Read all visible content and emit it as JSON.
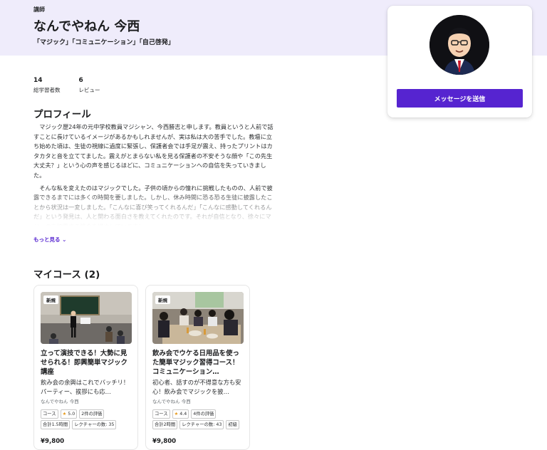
{
  "instructor": {
    "role": "講師",
    "name": "なんでやねん 今西",
    "tags": "「マジック」「コミュニケーション」「自己啓発」"
  },
  "stats": [
    {
      "value": "14",
      "label": "総学習者数"
    },
    {
      "value": "6",
      "label": "レビュー"
    }
  ],
  "side_card": {
    "message_button": "メッセージを送信"
  },
  "profile": {
    "title": "プロフィール",
    "paragraphs": [
      "マジック歴24年の元中学校教員マジシャン、今西勝志と申します。教員というと人前で話すことに長けているイメージがあるかもしれませんが、実は私は大の苦手でした。教壇に立ち始めた頃は、生徒の視線に過度に緊張し、保護者会では手足が震え、持ったプリントはカタカタと音を立ててました。震えがとまらない私を見る保護者の不安そうな顔や「この先生大丈夫？」という心の声を感じるほどに、コミュニケーションへの自信を失っていきました。",
      "そんな私を変えたのはマジックでした。子供の頃からの憧れに挑戦したものの、人前で披露できるまでには多くの時間を要しました。しかし、休み時間に恐る恐る生徒に披露したことから状況は一変しました。「こんなに喜び笑ってくれるんだ」「こんなに感動してくれるんだ」という発見は、人と関わる面白さを教えてくれたのです。それが自信となり、徐々にマジックを披露する機会を増やしていきまし"
    ],
    "more_label": "もっと見る ⌄"
  },
  "courses": {
    "title": "マイコース (2)",
    "items": [
      {
        "badge": "新規",
        "title": "立って演技できる！大勢に見せられる！即興簡単マジック講座",
        "desc": "飲み会の余興はこれでバッチリ！パーティー、挨拶にも応…",
        "author": "なんでやねん 今西",
        "type": "コース",
        "rating": "5.0",
        "reviews": "2件の評価",
        "duration": "合計1.5時間",
        "lectures": "レクチャーの数: 35",
        "level": "",
        "price": "¥9,800"
      },
      {
        "badge": "新規",
        "title": "飲み会でウケる日用品を使った簡単マジック習得コース！コミュニケーション…",
        "desc": "初心者、話すのが不得意な方も安心！飲み会でマジックを披…",
        "author": "なんでやねん 今西",
        "type": "コース",
        "rating": "4.4",
        "reviews": "4件の評価",
        "duration": "合計2時間",
        "lectures": "レクチャーの数: 43",
        "level": "初級",
        "price": "¥9,800"
      }
    ]
  },
  "colors": {
    "accent": "#5624d0",
    "hero_bg": "#efecfb",
    "star": "#e59819"
  }
}
